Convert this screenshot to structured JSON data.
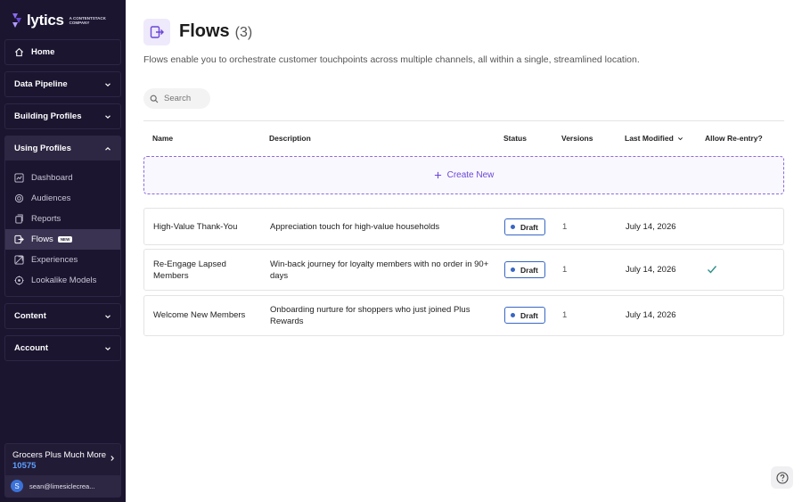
{
  "brand": {
    "name": "lytics",
    "tagline": "A CONTENTSTACK COMPANY",
    "accent": "#6a47d6"
  },
  "sidebar": {
    "home": {
      "label": "Home",
      "icon": "home-icon"
    },
    "sections": [
      {
        "label": "Data Pipeline",
        "expanded": false
      },
      {
        "label": "Building Profiles",
        "expanded": false
      },
      {
        "label": "Using Profiles",
        "expanded": true
      },
      {
        "label": "Content",
        "expanded": false
      },
      {
        "label": "Account",
        "expanded": false
      }
    ],
    "using_profiles_items": [
      {
        "label": "Dashboard",
        "icon": "dashboard-icon"
      },
      {
        "label": "Audiences",
        "icon": "audiences-icon"
      },
      {
        "label": "Reports",
        "icon": "reports-icon"
      },
      {
        "label": "Flows",
        "icon": "flows-icon",
        "active": true,
        "badge": "NEW"
      },
      {
        "label": "Experiences",
        "icon": "experiences-icon"
      },
      {
        "label": "Lookalike Models",
        "icon": "lookalike-icon"
      }
    ],
    "account": {
      "name": "Grocers Plus Much More",
      "id": "10575",
      "user_initial": "S",
      "email": "sean@limesiclecrea..."
    }
  },
  "page": {
    "title": "Flows",
    "count": "(3)",
    "description": "Flows enable you to orchestrate customer touchpoints across multiple channels, all within a single, streamlined location."
  },
  "search": {
    "placeholder": "Search"
  },
  "table": {
    "headers": {
      "name": "Name",
      "description": "Description",
      "status": "Status",
      "versions": "Versions",
      "last_modified": "Last Modified",
      "reentry": "Allow Re-entry?"
    },
    "create_new_label": "Create New",
    "rows": [
      {
        "name_line1": "High-Value Thank-You",
        "name_line2": "",
        "desc_line1": "Appreciation touch for high-value households",
        "desc_line2": "",
        "status": "Draft",
        "versions": "1",
        "last_modified": "July 14, 2026",
        "reentry": false
      },
      {
        "name_line1": "Re-Engage Lapsed",
        "name_line2": "Members",
        "desc_line1": "Win-back journey for loyalty members with no order in 90+",
        "desc_line2": "days",
        "status": "Draft",
        "versions": "1",
        "last_modified": "July 14, 2026",
        "reentry": true
      },
      {
        "name_line1": "Welcome New Members",
        "name_line2": "",
        "desc_line1": "Onboarding nurture for shoppers who just joined Plus",
        "desc_line2": "Rewards",
        "status": "Draft",
        "versions": "1",
        "last_modified": "July 14, 2026",
        "reentry": false
      }
    ]
  }
}
